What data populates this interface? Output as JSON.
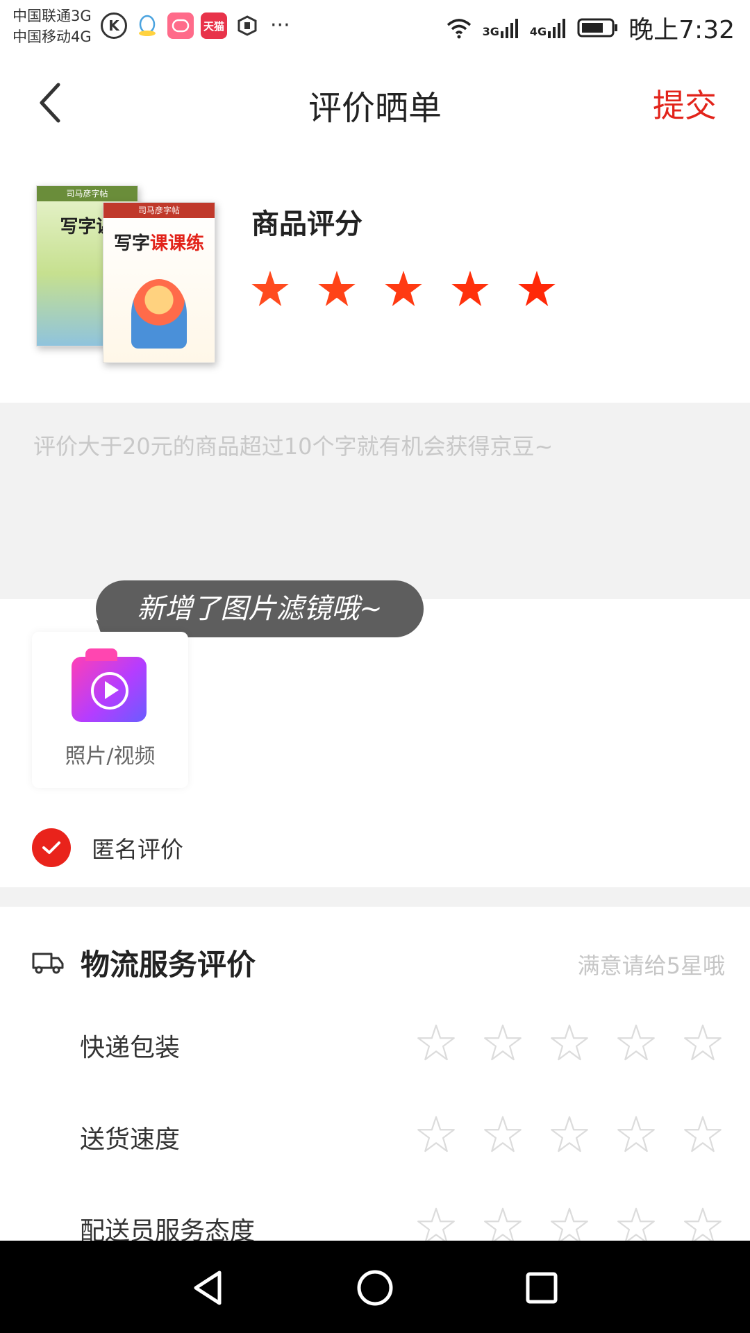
{
  "status_bar": {
    "carrier1": "中国联通3G",
    "carrier2": "中国移动4G",
    "apps": [
      {
        "icon": "k-app-icon",
        "color": "#333333",
        "text": "K"
      },
      {
        "icon": "qq-icon",
        "color": "#ffffff",
        "text": ""
      },
      {
        "icon": "chat-app-icon",
        "color": "#ff6b8a",
        "text": ""
      },
      {
        "icon": "tmall-icon",
        "color": "#e8334a",
        "text": "天猫"
      },
      {
        "icon": "vpn-shield-icon",
        "color": "#333333",
        "text": ""
      }
    ],
    "more": "···",
    "net1": "3G",
    "net2": "4G",
    "time": "晚上7:32"
  },
  "header": {
    "title": "评价晒单",
    "submit_label": "提交"
  },
  "product": {
    "cover1_band": "司马彦字帖",
    "cover1_title": "写字课",
    "cover2_band": "司马彦字帖",
    "cover2_title_a": "写字",
    "cover2_title_b": "课课练",
    "rating_label": "商品评分",
    "rating": 5,
    "star_colors": [
      "#ff4b1f",
      "#ff4318",
      "#ff3a12",
      "#ff310c",
      "#ff2808"
    ]
  },
  "comment": {
    "placeholder": "评价大于20元的商品超过10个字就有机会获得京豆~"
  },
  "tooltip": {
    "text": "新增了图片滤镜哦~"
  },
  "upload": {
    "label": "照片/视频"
  },
  "anonymous": {
    "label": "匿名评价",
    "checked": true
  },
  "logistics": {
    "title": "物流服务评价",
    "hint": "满意请给5星哦",
    "rows": [
      {
        "label": "快递包装",
        "rating": 0
      },
      {
        "label": "送货速度",
        "rating": 0
      },
      {
        "label": "配送员服务态度",
        "rating": 0
      }
    ]
  },
  "colors": {
    "accent": "#e2231a",
    "panel": "#f2f2f2"
  }
}
